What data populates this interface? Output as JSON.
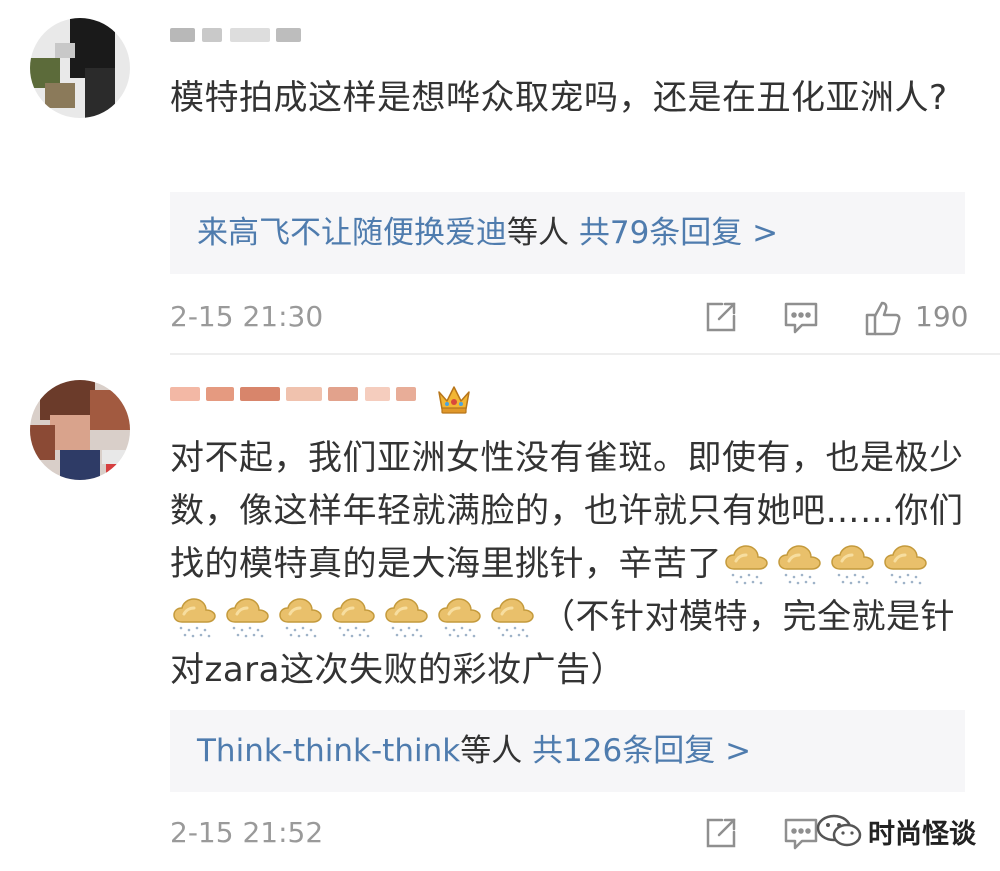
{
  "comments": [
    {
      "text": "模特拍成这样是想哗众取宠吗，还是在丑化亚洲人?",
      "replies": {
        "names": "来高飞不让随便换爱迪",
        "middle": "等人",
        "count_label": "共79条回复 >"
      },
      "timestamp": "2-15 21:30",
      "likes": "190"
    },
    {
      "text": "对不起，我们亚洲女性没有雀斑。即使有，也是极少数，像这样年轻就满脸的，也许就只有她吧……你们找的模特真的是大海里挑针，辛苦了",
      "tail_text": "（不针对模特，完全就是针对zara这次失败的彩妆广告）",
      "cloud_icon_count": 11,
      "replies": {
        "names": "Think-think-think",
        "middle": "等人",
        "count_label": "共126条回复 >"
      },
      "timestamp": "2-15 21:52"
    }
  ],
  "watermark": {
    "text": "时尚怪谈",
    "icon": "wechat-icon"
  },
  "icons": {
    "share": "share-icon",
    "comment": "comment-icon",
    "like": "thumbs-up-icon",
    "badge": "crown-icon",
    "emoji": "rain-cloud-emoji"
  },
  "colors": {
    "link": "#4f7cae",
    "reply_bg": "#f6f6f8",
    "meta": "#9a9a9a",
    "text": "#333333"
  }
}
